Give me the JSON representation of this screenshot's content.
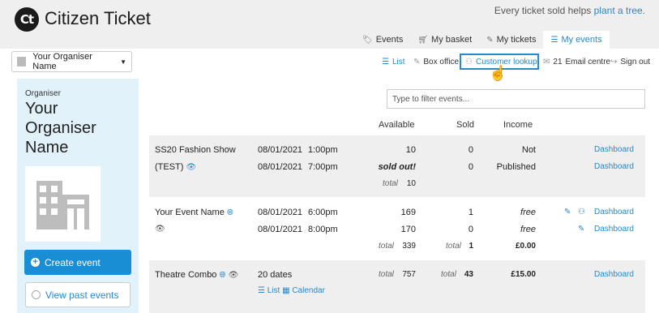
{
  "brand": {
    "logo_mark": "Ct",
    "name": "Citizen Ticket"
  },
  "tagline": {
    "text": "Every ticket sold helps",
    "link": "plant a tree."
  },
  "tabs": [
    {
      "label": "Events",
      "icon": "tag-icon"
    },
    {
      "label": "My basket",
      "icon": "basket-icon"
    },
    {
      "label": "My tickets",
      "icon": "ticket-icon"
    },
    {
      "label": "My events",
      "icon": "sliders-icon",
      "active": true
    }
  ],
  "org_selector": {
    "value": "Your Organiser Name"
  },
  "sidebar": {
    "label": "Organiser",
    "name": "Your Organiser Name",
    "create_label": "Create event",
    "past_label": "View past events"
  },
  "toolbar": {
    "list": "List",
    "box_office": "Box office",
    "customer_lookup": "Customer lookup",
    "email_count": "21",
    "email_centre": "Email centre",
    "sign_out": "Sign out"
  },
  "filter": {
    "placeholder": "Type to filter events..."
  },
  "table": {
    "headers": {
      "available": "Available",
      "sold": "Sold",
      "income": "Income"
    },
    "events": [
      {
        "name_line1": "SS20 Fashion Show",
        "name_line2": "(TEST)",
        "dates": [
          {
            "date": "08/01/2021",
            "time": "1:00pm",
            "available": "10",
            "sold": "0",
            "income": "Not",
            "action": "Dashboard"
          },
          {
            "date": "08/01/2021",
            "time": "7:00pm",
            "available": "sold out!",
            "sold": "0",
            "income": "Published",
            "action": "Dashboard"
          }
        ],
        "total_label": "total",
        "total_available": "10"
      },
      {
        "name_line1": "Your Event Name",
        "dates": [
          {
            "date": "08/01/2021",
            "time": "6:00pm",
            "available": "169",
            "sold": "1",
            "income": "free",
            "action": "Dashboard"
          },
          {
            "date": "08/01/2021",
            "time": "8:00pm",
            "available": "170",
            "sold": "0",
            "income": "free",
            "action": "Dashboard"
          }
        ],
        "total_label": "total",
        "total_available": "339",
        "total_sold_label": "total",
        "total_sold": "1",
        "total_income": "£0.00"
      },
      {
        "name_line1": "Theatre Combo",
        "dates_text": "20 dates",
        "list_link": "List",
        "calendar_link": "Calendar",
        "total_label": "total",
        "total_available": "757",
        "total_sold_label": "total",
        "total_sold": "43",
        "total_income": "£15.00",
        "action": "Dashboard"
      }
    ]
  },
  "colors": {
    "accent": "#2a88c8",
    "button": "#1a8ed4",
    "sidebar": "#e2f2fb"
  }
}
